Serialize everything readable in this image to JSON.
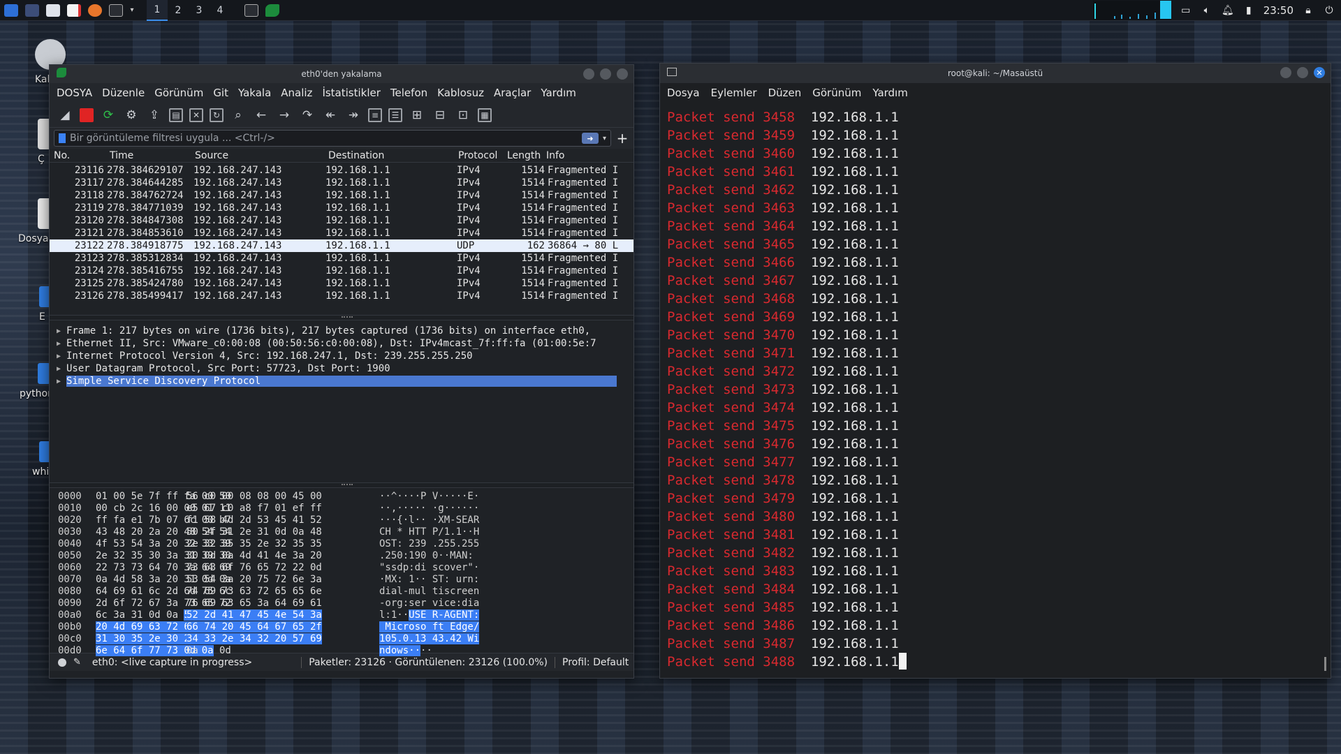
{
  "panel": {
    "workspaces": [
      "1",
      "2",
      "3",
      "4"
    ],
    "active_workspace": "1",
    "clock": "23:50"
  },
  "desktop": {
    "icons": [
      "Kali",
      "Ç",
      "Dosya",
      "E",
      "python",
      "whi"
    ]
  },
  "wireshark": {
    "title": "eth0'den yakalama",
    "menu": [
      "DOSYA",
      "Düzenle",
      "Görünüm",
      "Git",
      "Yakala",
      "Analiz",
      "İstatistikler",
      "Telefon",
      "Kablosuz",
      "Araçlar",
      "Yardım"
    ],
    "filter_placeholder": "Bir görüntüleme filtresi uygula ... <Ctrl-/>",
    "columns": [
      "No.",
      "Time",
      "Source",
      "Destination",
      "Protocol",
      "Length",
      "Info"
    ],
    "packets": [
      {
        "no": "23116",
        "time": "278.384629107",
        "src": "192.168.247.143",
        "dst": "192.168.1.1",
        "proto": "IPv4",
        "len": "1514",
        "info": "Fragmented I"
      },
      {
        "no": "23117",
        "time": "278.384644285",
        "src": "192.168.247.143",
        "dst": "192.168.1.1",
        "proto": "IPv4",
        "len": "1514",
        "info": "Fragmented I"
      },
      {
        "no": "23118",
        "time": "278.384762724",
        "src": "192.168.247.143",
        "dst": "192.168.1.1",
        "proto": "IPv4",
        "len": "1514",
        "info": "Fragmented I"
      },
      {
        "no": "23119",
        "time": "278.384771039",
        "src": "192.168.247.143",
        "dst": "192.168.1.1",
        "proto": "IPv4",
        "len": "1514",
        "info": "Fragmented I"
      },
      {
        "no": "23120",
        "time": "278.384847308",
        "src": "192.168.247.143",
        "dst": "192.168.1.1",
        "proto": "IPv4",
        "len": "1514",
        "info": "Fragmented I"
      },
      {
        "no": "23121",
        "time": "278.384853610",
        "src": "192.168.247.143",
        "dst": "192.168.1.1",
        "proto": "IPv4",
        "len": "1514",
        "info": "Fragmented I"
      },
      {
        "no": "23122",
        "time": "278.384918775",
        "src": "192.168.247.143",
        "dst": "192.168.1.1",
        "proto": "UDP",
        "len": "162",
        "info": "36864 → 80 L"
      },
      {
        "no": "23123",
        "time": "278.385312834",
        "src": "192.168.247.143",
        "dst": "192.168.1.1",
        "proto": "IPv4",
        "len": "1514",
        "info": "Fragmented I"
      },
      {
        "no": "23124",
        "time": "278.385416755",
        "src": "192.168.247.143",
        "dst": "192.168.1.1",
        "proto": "IPv4",
        "len": "1514",
        "info": "Fragmented I"
      },
      {
        "no": "23125",
        "time": "278.385424780",
        "src": "192.168.247.143",
        "dst": "192.168.1.1",
        "proto": "IPv4",
        "len": "1514",
        "info": "Fragmented I"
      },
      {
        "no": "23126",
        "time": "278.385499417",
        "src": "192.168.247.143",
        "dst": "192.168.1.1",
        "proto": "IPv4",
        "len": "1514",
        "info": "Fragmented I"
      }
    ],
    "selected_packet_no": "23122",
    "details": [
      "Frame 1: 217 bytes on wire (1736 bits), 217 bytes captured (1736 bits) on interface eth0,",
      "Ethernet II, Src: VMware_c0:00:08 (00:50:56:c0:00:08), Dst: IPv4mcast_7f:ff:fa (01:00:5e:7",
      "Internet Protocol Version 4, Src: 192.168.247.1, Dst: 239.255.255.250",
      "User Datagram Protocol, Src Port: 57723, Dst Port: 1900",
      "Simple Service Discovery Protocol"
    ],
    "selected_detail": "Simple Service Discovery Protocol",
    "hex": [
      {
        "off": "0000",
        "a": "01 00 5e 7f ff fa 00 50",
        "b": "56 c0 00 08 08 00 45 00",
        "asc": "··^····P V·····E·"
      },
      {
        "off": "0010",
        "a": "00 cb 2c 16 00 00 01 11",
        "b": "e5 67 c0 a8 f7 01 ef ff",
        "asc": "··,····· ·g······"
      },
      {
        "off": "0020",
        "a": "ff fa e1 7b 07 6c 00 b7",
        "b": "f1 58 4d 2d 53 45 41 52",
        "asc": "···{·l·· ·XM-SEAR"
      },
      {
        "off": "0030",
        "a": "43 48 20 2a 20 48 54 54",
        "b": "50 2f 31 2e 31 0d 0a 48",
        "asc": "CH * HTT P/1.1··H"
      },
      {
        "off": "0040",
        "a": "4f 53 54 3a 20 32 33 39",
        "b": "2e 32 35 35 2e 32 35 35",
        "asc": "OST: 239 .255.255"
      },
      {
        "off": "0050",
        "a": "2e 32 35 30 3a 31 39 30",
        "b": "30 0d 0a 4d 41 4e 3a 20",
        "asc": ".250:190 0··MAN: "
      },
      {
        "off": "0060",
        "a": "22 73 73 64 70 3a 64 69",
        "b": "73 63 6f 76 65 72 22 0d",
        "asc": "\"ssdp:di scover\"·"
      },
      {
        "off": "0070",
        "a": "0a 4d 58 3a 20 31 0d 0a",
        "b": "53 54 3a 20 75 72 6e 3a",
        "asc": "·MX: 1·· ST: urn:"
      },
      {
        "off": "0080",
        "a": "64 69 61 6c 2d 6d 75 6c",
        "b": "74 69 73 63 72 65 65 6e",
        "asc": "dial-mul tiscreen"
      },
      {
        "off": "0090",
        "a": "2d 6f 72 67 3a 73 65 72",
        "b": "76 69 63 65 3a 64 69 61",
        "asc": "-org:ser vice:dia"
      },
      {
        "off": "00a0",
        "a": "6c 3a 31 0d 0a ",
        "a_hl": "55 53 45",
        "b_hl": "52 2d 41 47 45 4e 54 3a",
        "asc": "l:1··",
        "asc_hl": "USE R-AGENT:"
      },
      {
        "off": "00b0",
        "a_hl": "20 4d 69 63 72 6f 73 6f",
        "b_hl": "66 74 20 45 64 67 65 2f",
        "asc_hl": " Microso ft Edge/"
      },
      {
        "off": "00c0",
        "a_hl": "31 30 35 2e 30 2e 31 33",
        "b_hl": "34 33 2e 34 32 20 57 69",
        "asc_hl": "105.0.13 43.42 Wi"
      },
      {
        "off": "00d0",
        "a_hl": "6e 64 6f 77 73 0d 0a",
        "a_tail": " 0d",
        "b": "0a",
        "asc_hl": "ndows··",
        "asc_tail": "··"
      }
    ],
    "status": {
      "interface": "eth0: <live capture in progress>",
      "packets": "Paketler: 23126 · Görüntülenen: 23126 (100.0%)",
      "profile": "Profil: Default"
    }
  },
  "terminal": {
    "title": "root@kali: ~/Masaüstü",
    "menu": [
      "Dosya",
      "Eylemler",
      "Düzen",
      "Görünüm",
      "Yardım"
    ],
    "line_prefix": "Packet send",
    "ip": "192.168.1.1",
    "first_packet": 3458,
    "last_packet": 3488
  },
  "colors": {
    "accent": "#3b7ef5",
    "terminal_red": "#d9292f"
  }
}
